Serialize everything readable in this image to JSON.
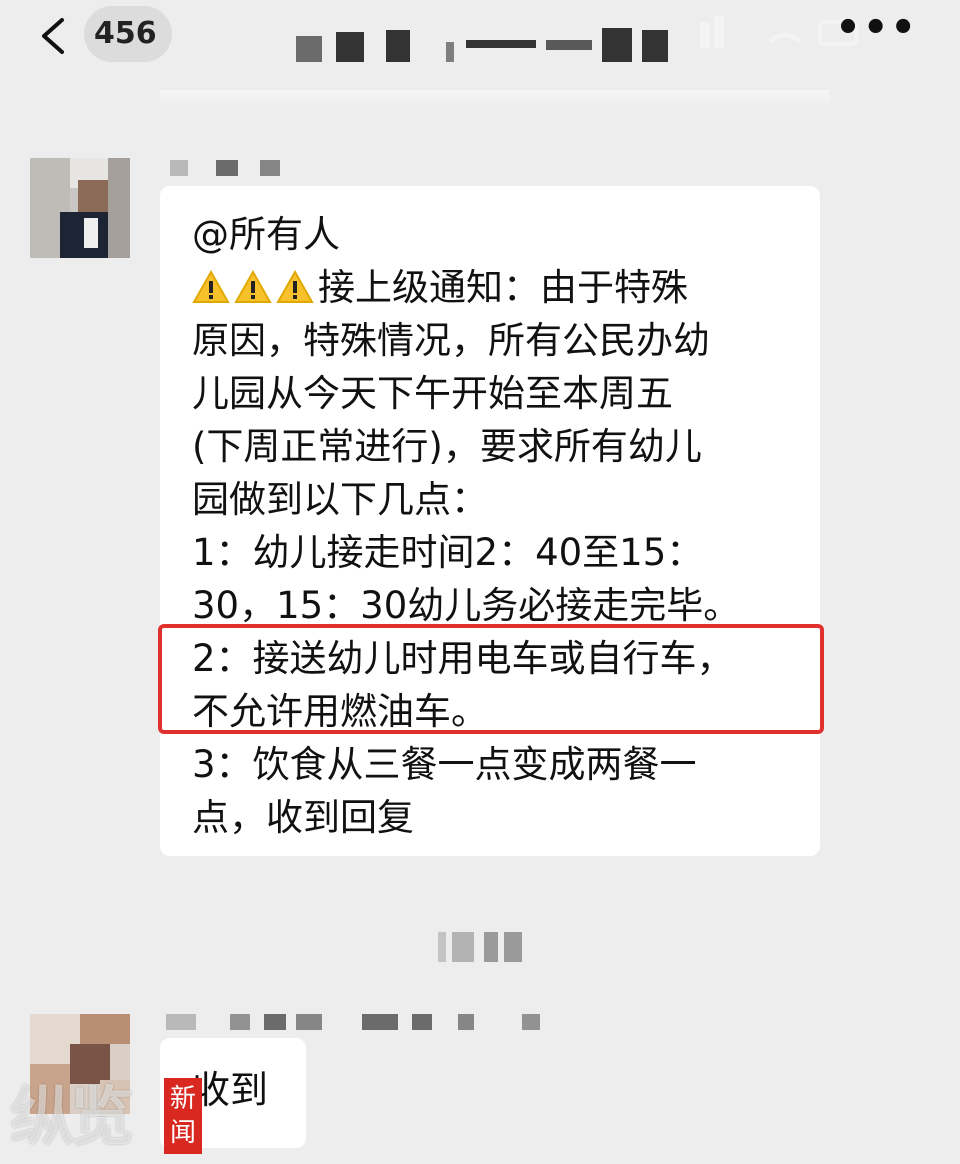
{
  "header": {
    "back_icon": "chevron-left-icon",
    "unread_count": "456",
    "more_label": "•••"
  },
  "messages": [
    {
      "lines": [
        "@所有人",
        "接上级通知：由于特殊",
        "原因，特殊情况，所有公民办幼",
        "儿园从今天下午开始至本周五",
        "(下周正常进行)，要求所有幼儿",
        "园做到以下几点：",
        "1：幼儿接走时间2：40至15：",
        "30，15：30幼儿务必接走完毕。",
        "2：接送幼儿时用电车或自行车，",
        "不允许用燃油车。",
        "3：饮食从三餐一点变成两餐一",
        "点，收到回复"
      ],
      "warning_icon": "warning-icon",
      "highlight_color": "#e0312f"
    },
    {
      "lines": [
        "收到"
      ]
    }
  ],
  "watermark": {
    "logo_text": "新闻",
    "text": "纵览"
  }
}
